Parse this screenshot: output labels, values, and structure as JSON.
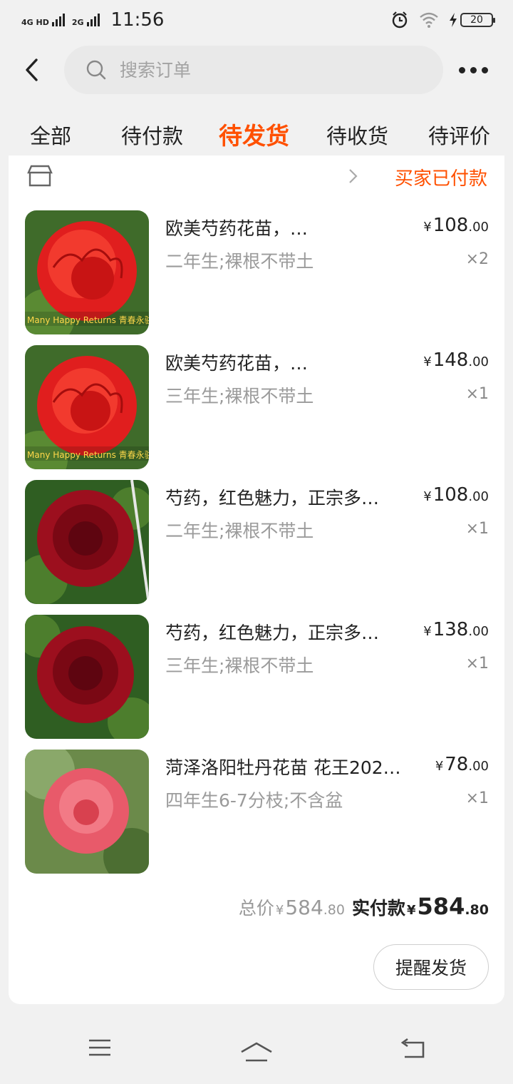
{
  "status_bar": {
    "network_1": "4G HD",
    "network_2": "2G",
    "time": "11:56",
    "battery": "20"
  },
  "search": {
    "placeholder": "搜索订单"
  },
  "tabs": [
    {
      "label": "全部"
    },
    {
      "label": "待付款"
    },
    {
      "label": "待发货",
      "active": true
    },
    {
      "label": "待收货"
    },
    {
      "label": "待评价"
    }
  ],
  "order": {
    "shop_name": "",
    "status": "买家已付款",
    "items": [
      {
        "title": "欧美芍药花苗，…",
        "sku": "二年生;裸根不带土",
        "price_int": "108",
        "price_dec": ".00",
        "qty": "×2"
      },
      {
        "title": "欧美芍药花苗，…",
        "sku": "三年生;裸根不带土",
        "price_int": "148",
        "price_dec": ".00",
        "qty": "×1"
      },
      {
        "title": "芍药，红色魅力，正宗多…",
        "sku": "二年生;裸根不带土",
        "price_int": "108",
        "price_dec": ".00",
        "qty": "×1"
      },
      {
        "title": "芍药，红色魅力，正宗多…",
        "sku": "三年生;裸根不带土",
        "price_int": "138",
        "price_dec": ".00",
        "qty": "×1"
      },
      {
        "title": "菏泽洛阳牡丹花苗  花王202…",
        "sku": "四年生6-7分枝;不含盆",
        "price_int": "78",
        "price_dec": ".00",
        "qty": "×1"
      }
    ],
    "image_text": "Many Happy Returns 青春永驻",
    "currency": "¥",
    "total_label": "总价",
    "total_int": "584",
    "total_dec": ".80",
    "paid_label": "实付款",
    "paid_int": "584",
    "paid_dec": ".80",
    "remind_button": "提醒发货"
  },
  "colors": {
    "accent": "#ff5000",
    "background": "#f1f1f1",
    "card": "#ffffff"
  },
  "icons": [
    "back-arrow-icon",
    "search-icon",
    "more-dots-icon",
    "shop-icon",
    "chevron-right-icon",
    "menu-icon",
    "home-icon",
    "return-icon",
    "alarm-icon",
    "wifi-icon",
    "charging-icon"
  ]
}
